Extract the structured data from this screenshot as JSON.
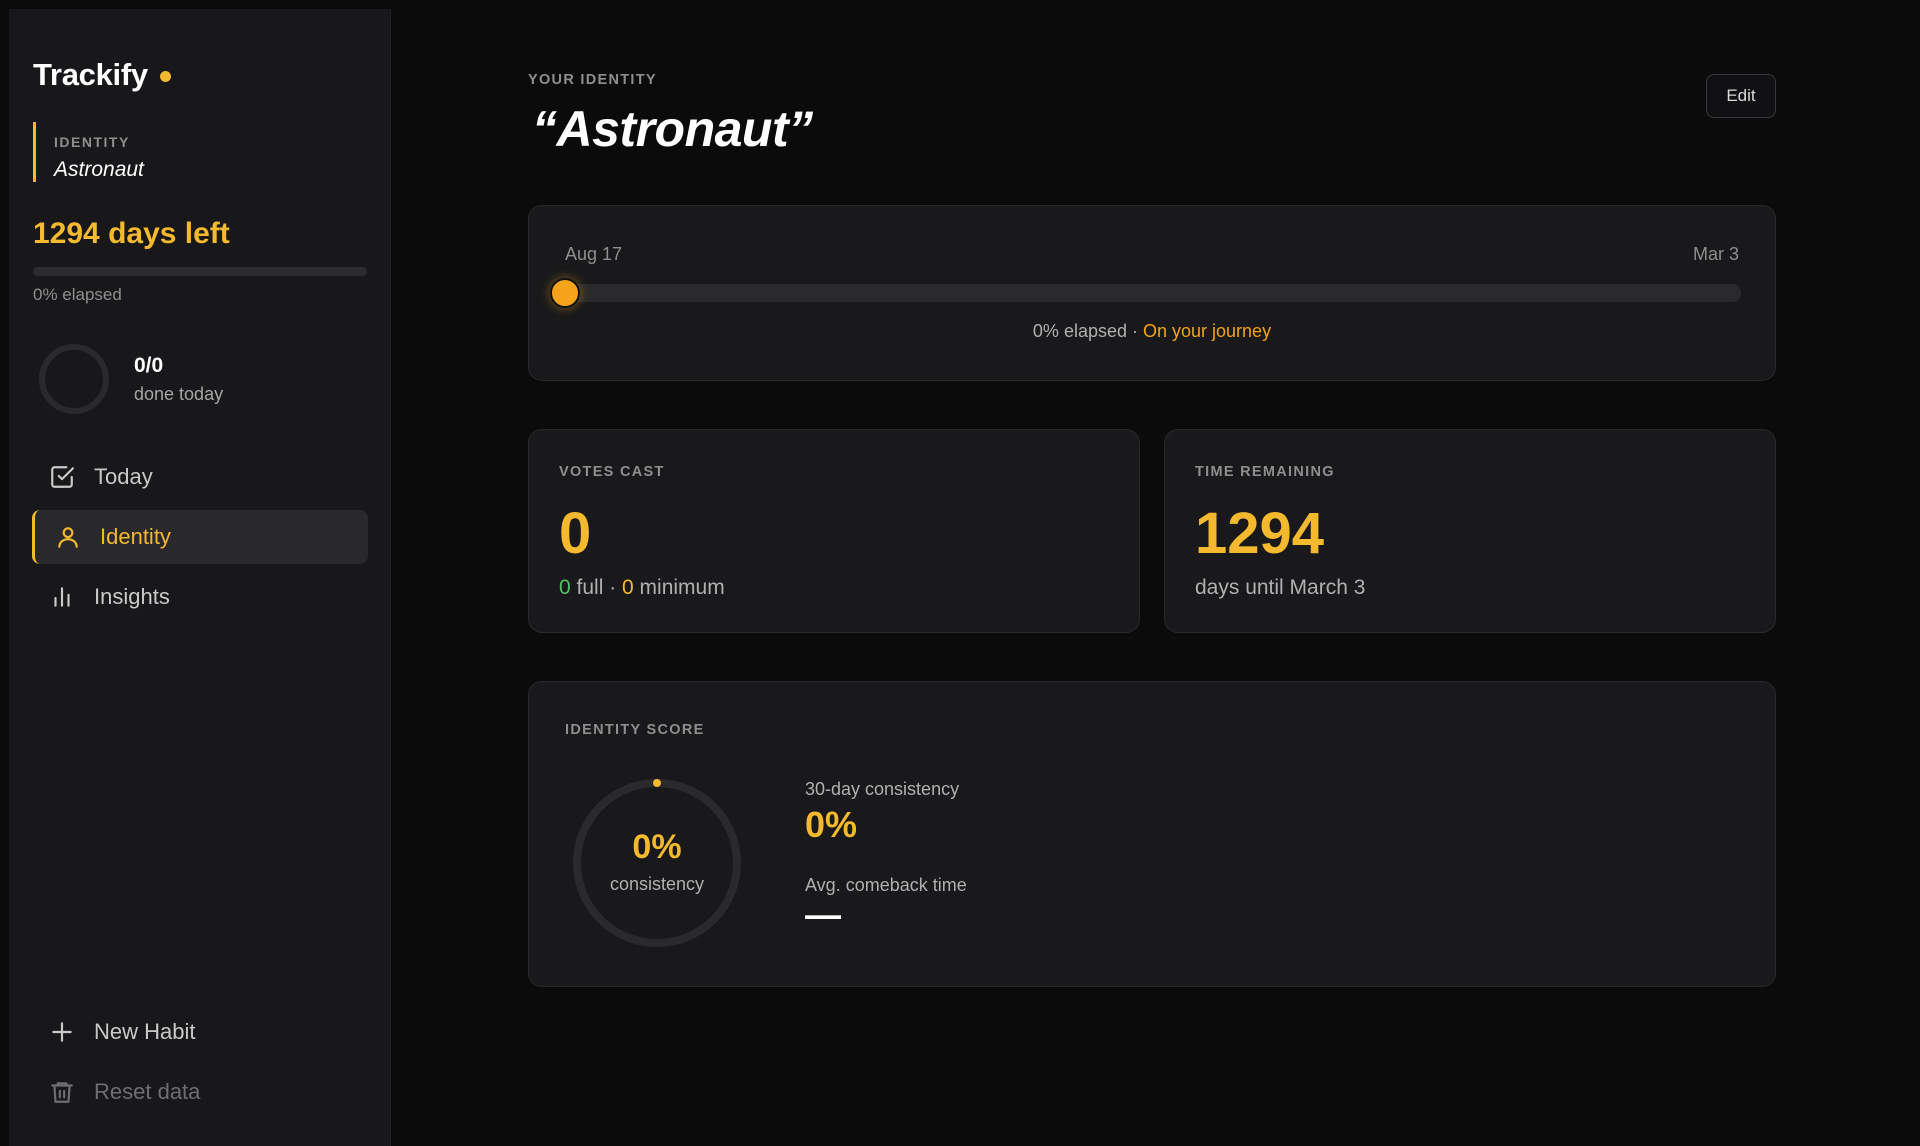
{
  "sidebar": {
    "brand": "Trackify",
    "identity_label": "IDENTITY",
    "identity_value": "Astronaut",
    "days_left": "1294 days left",
    "elapsed_fraction": 0.0,
    "elapsed_text": "0% elapsed",
    "today_count": "0/0",
    "today_label": "done today",
    "nav": [
      {
        "label": "Today",
        "icon": "checkbox-icon"
      },
      {
        "label": "Identity",
        "icon": "user-icon",
        "active": true
      },
      {
        "label": "Insights",
        "icon": "bar-chart-icon"
      }
    ],
    "new_habit": "New Habit",
    "reset_data": "Reset data"
  },
  "header": {
    "eyebrow": "YOUR IDENTITY",
    "title": "“Astronaut”",
    "edit_label": "Edit"
  },
  "timeline": {
    "start": "Aug 17",
    "end": "Mar 3",
    "progress": 0.0,
    "caption": "0% elapsed · ",
    "status": "On your journey"
  },
  "votes": {
    "label": "VOTES CAST",
    "value": "0",
    "full_count": "0",
    "full_label": " full · ",
    "min_count": "0",
    "min_label": " minimum"
  },
  "time_remaining": {
    "label": "TIME REMAINING",
    "value": "1294",
    "sub": "days until March 3"
  },
  "score": {
    "label": "IDENTITY SCORE",
    "ring_value": "0%",
    "ring_label": "consistency",
    "consistency_fraction": 0.0,
    "m1_label": "30-day consistency",
    "m1_value": "0%",
    "m2_label": "Avg. comeback time",
    "m2_value": "—"
  },
  "colors": {
    "accent": "#f4b92e",
    "background": "#0b0b0c",
    "card": "#19191b",
    "success": "#4cc26a"
  }
}
